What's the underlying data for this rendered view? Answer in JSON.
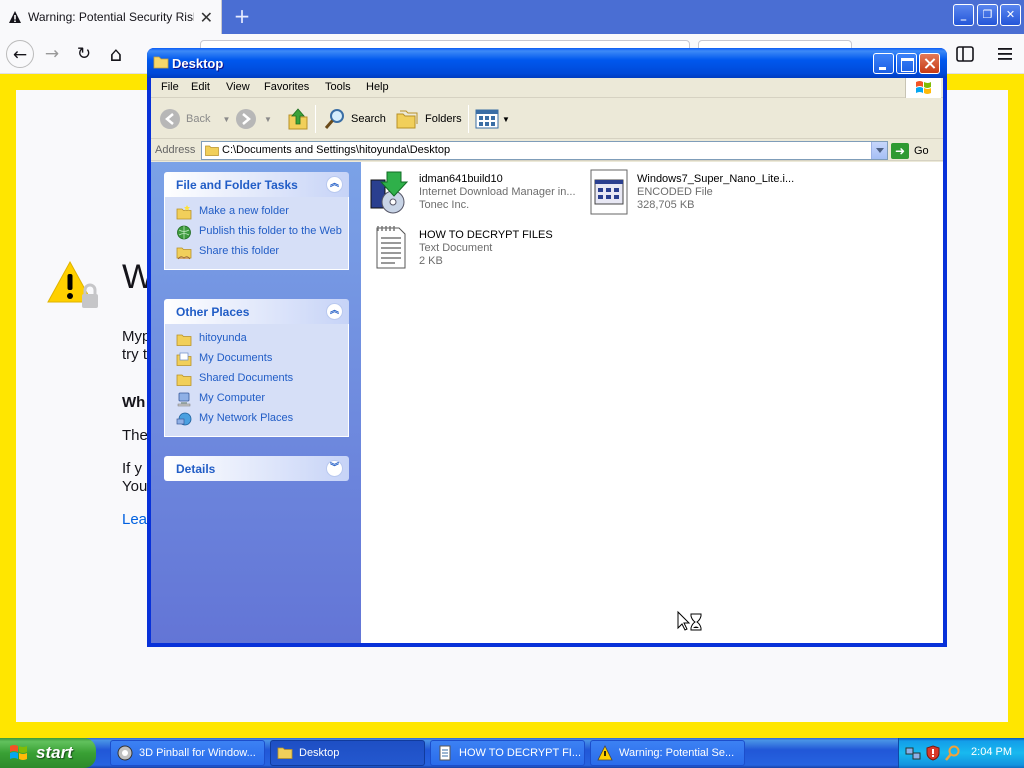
{
  "browser": {
    "tab_title": "Warning: Potential Security Risk Ahead",
    "tab_close": "✕",
    "new_tab": "+",
    "back": "←",
    "forward": "→",
    "reload": "↻",
    "home": "⌂",
    "page": {
      "heading": "W",
      "p1_line1": "Myp",
      "p1_line2": "try t",
      "what_heading": "Wh",
      "the_line": "The",
      "if_line1": "If y",
      "if_line2": "You",
      "learn_more": "Lear"
    }
  },
  "explorer": {
    "title": "Desktop",
    "menu": [
      "File",
      "Edit",
      "View",
      "Favorites",
      "Tools",
      "Help"
    ],
    "toolbar": {
      "back": "Back",
      "search": "Search",
      "folders": "Folders"
    },
    "address": {
      "label": "Address",
      "value": "C:\\Documents and Settings\\hitoyunda\\Desktop",
      "go": "Go"
    },
    "taskpane": {
      "file_tasks": {
        "title": "File and Folder Tasks",
        "items": [
          "Make a new folder",
          "Publish this folder to the Web",
          "Share this folder"
        ]
      },
      "other_places": {
        "title": "Other Places",
        "items": [
          "hitoyunda",
          "My Documents",
          "Shared Documents",
          "My Computer",
          "My Network Places"
        ]
      },
      "details": {
        "title": "Details"
      }
    },
    "files": [
      {
        "name": "idman641build10",
        "type": "Internet Download Manager in...",
        "extra": "Tonec Inc."
      },
      {
        "name": "Windows7_Super_Nano_Lite.i...",
        "type": "ENCODED File",
        "extra": "328,705 KB"
      },
      {
        "name": "HOW TO DECRYPT FILES",
        "type": "Text Document",
        "extra": "2 KB"
      }
    ]
  },
  "taskbar": {
    "start": "start",
    "tasks": [
      "3D Pinball for Window...",
      "Desktop",
      "HOW TO DECRYPT FI...",
      "Warning: Potential Se..."
    ],
    "clock": "2:04 PM"
  },
  "colors": {
    "xp_blue": "#0054e3",
    "taskpane_link": "#215dc6",
    "warning_yellow": "#ffe600",
    "start_green": "#3c9a3c"
  }
}
